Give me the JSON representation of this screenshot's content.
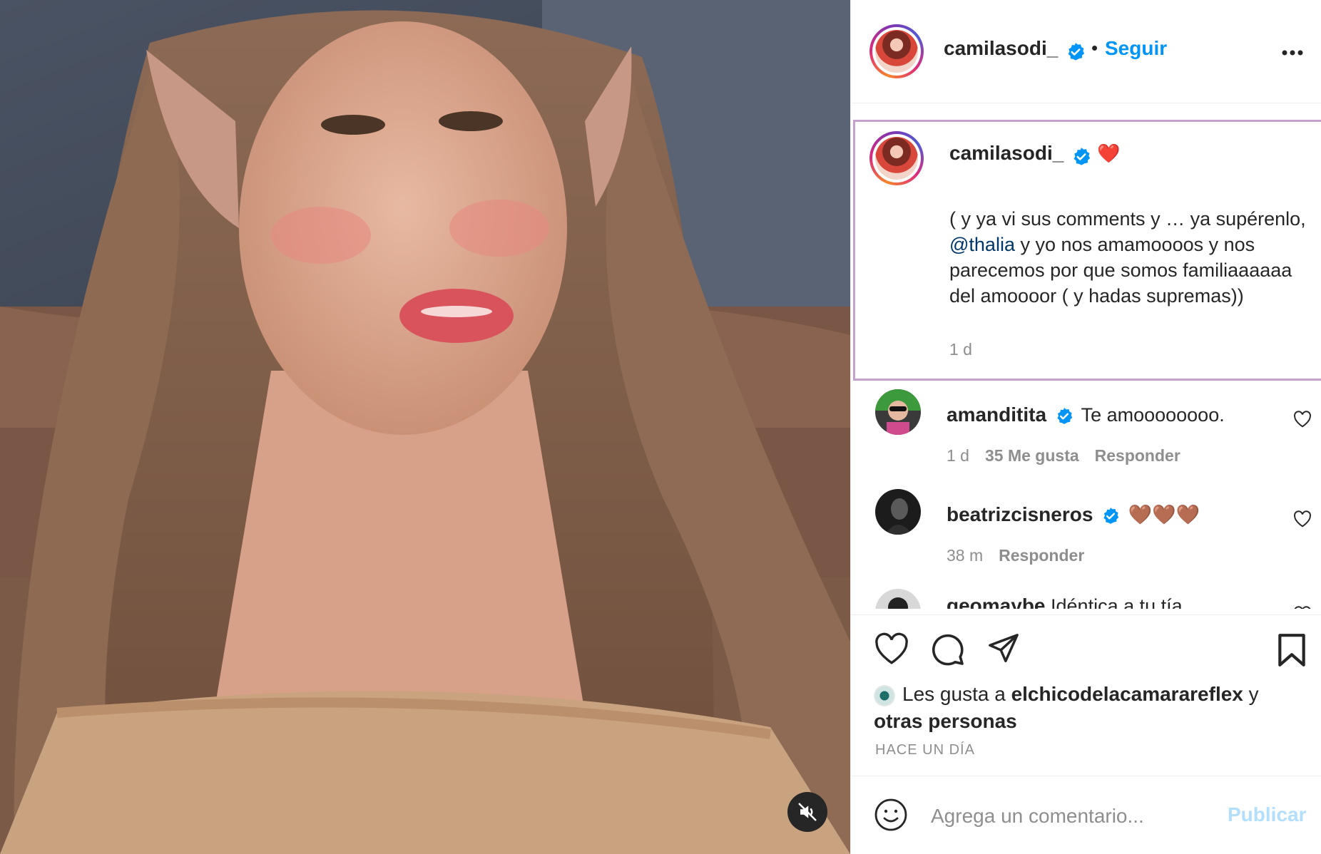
{
  "post": {
    "author": "camilasodi_",
    "follow_label": "Seguir",
    "dot": "•",
    "more_icon": "more-options-icon",
    "verified_color": "#0095f6"
  },
  "caption": {
    "username": "camilasodi_",
    "emoji": "❤️",
    "text_before": "( y ya vi sus comments y … ya supérenlo, ",
    "mention": "@thalia",
    "text_after": " y yo nos amamoooos y nos parecemos por que somos familiaaaaaa del amoooor ( y hadas supremas))",
    "time": "1 d"
  },
  "comments": [
    {
      "username": "amanditita",
      "text": "Te amoooooooo.",
      "time": "1 d",
      "likes": "35 Me gusta",
      "reply": "Responder"
    },
    {
      "username": "beatrizcisneros",
      "text": "🤎🤎🤎",
      "time": "38 m",
      "reply": "Responder"
    },
    {
      "username": "geomaybe",
      "text": "Idéntica a tu tía"
    }
  ],
  "actions": {
    "like_icon": "heart-icon",
    "comment_icon": "comment-icon",
    "share_icon": "share-icon",
    "save_icon": "bookmark-icon",
    "likes_prefix": "Les gusta a ",
    "likes_user": "elchicodelacamarareflex",
    "likes_joiner": " y ",
    "likes_others": "otras personas",
    "time_ago": "HACE UN DÍA"
  },
  "add_comment": {
    "placeholder": "Agrega un comentario...",
    "publish_label": "Publicar",
    "emoji_icon": "emoji-icon"
  },
  "media": {
    "mute_icon": "muted-speaker-icon"
  }
}
